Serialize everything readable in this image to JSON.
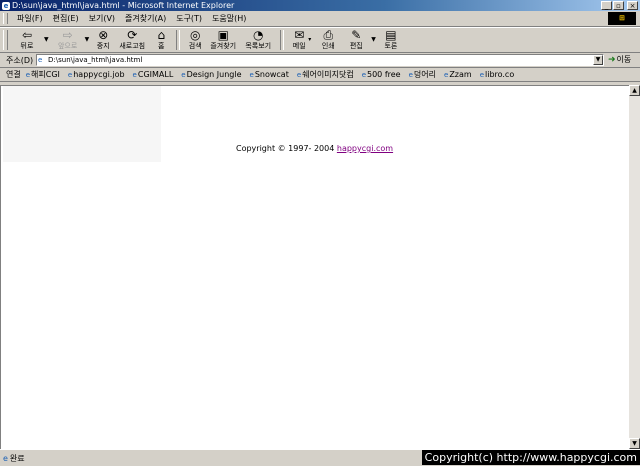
{
  "window": {
    "title": "D:\\sun\\java_html\\java.html - Microsoft Internet Explorer",
    "controls": {
      "minimize": "_",
      "maximize": "▫",
      "close": "×"
    }
  },
  "menubar": {
    "items": [
      "파일(F)",
      "편집(E)",
      "보기(V)",
      "즐겨찾기(A)",
      "도구(T)",
      "도움말(H)"
    ]
  },
  "toolbar": {
    "back": "뒤로",
    "forward": "앞으로",
    "stop": "중지",
    "refresh": "새로고침",
    "home": "홈",
    "search": "검색",
    "favorites": "즐겨찾기",
    "history": "목록보기",
    "mail": "메일",
    "print": "인쇄",
    "edit": "편집",
    "discuss": "토론"
  },
  "address": {
    "label": "주소(D)",
    "value": "D:\\sun\\java_html\\java.html",
    "go": "이동"
  },
  "links": {
    "label": "연결",
    "items": [
      "해피CGI",
      "happycgi.job",
      "CGIMALL",
      "Design Jungle",
      "Snowcat",
      "쉐어이미지닷컴",
      "500 free",
      "덩어리",
      "Zzam",
      "libro.co"
    ]
  },
  "content": {
    "copyright_text": "Copyright © 1997- 2004 ",
    "copyright_link": "happycgi.com"
  },
  "status": {
    "text": "완료"
  },
  "watermark": "Copyright(c) http://www.happycgi.com"
}
